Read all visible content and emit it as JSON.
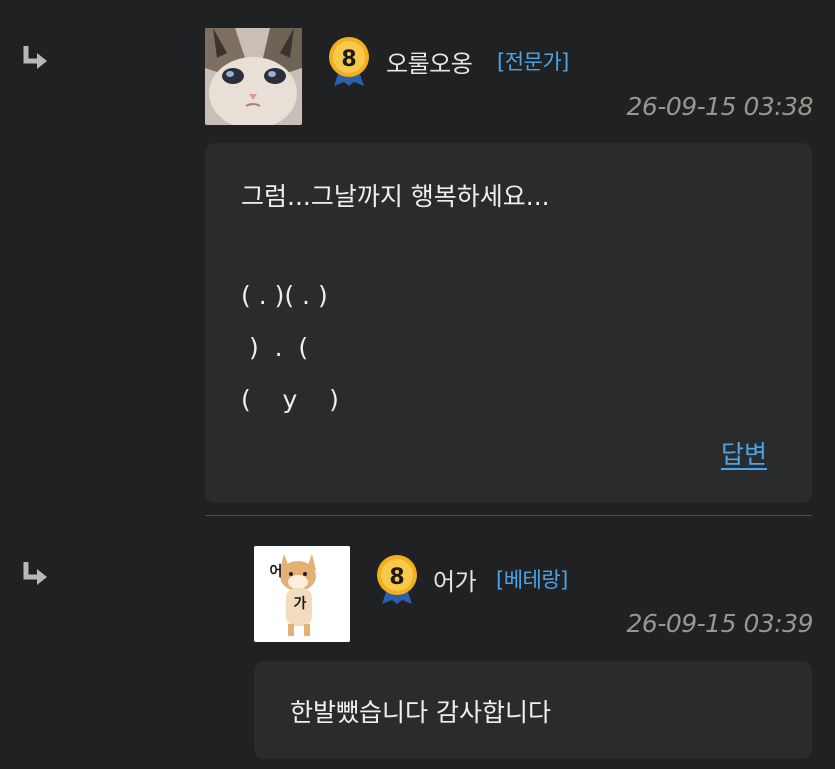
{
  "comments": [
    {
      "nickname": "오룰오옹",
      "rank": "[전문가]",
      "level": "8",
      "timestamp": "26-09-15 03:38",
      "lines": [
        "그럼...그날까지 행복하세요...",
        "",
        "( . )( . )",
        " )  .  (",
        "(    y    )"
      ],
      "reply_label": "답변"
    },
    {
      "nickname": "어가",
      "rank": "[베테랑]",
      "level": "8",
      "timestamp": "26-09-15 03:39",
      "lines": [
        "한발뺐습니다 감사합니다"
      ],
      "avatar_text_1": "어",
      "avatar_text_2": "가"
    }
  ],
  "icons": {
    "reply_arrow": "reply-arrow-icon",
    "level_badge": "level-badge-icon"
  },
  "colors": {
    "background": "#202122",
    "bubble": "#2a2b2c",
    "rank": "#4da3e6",
    "timestamp": "#9a968c",
    "badge_gold": "#f2b01e"
  }
}
